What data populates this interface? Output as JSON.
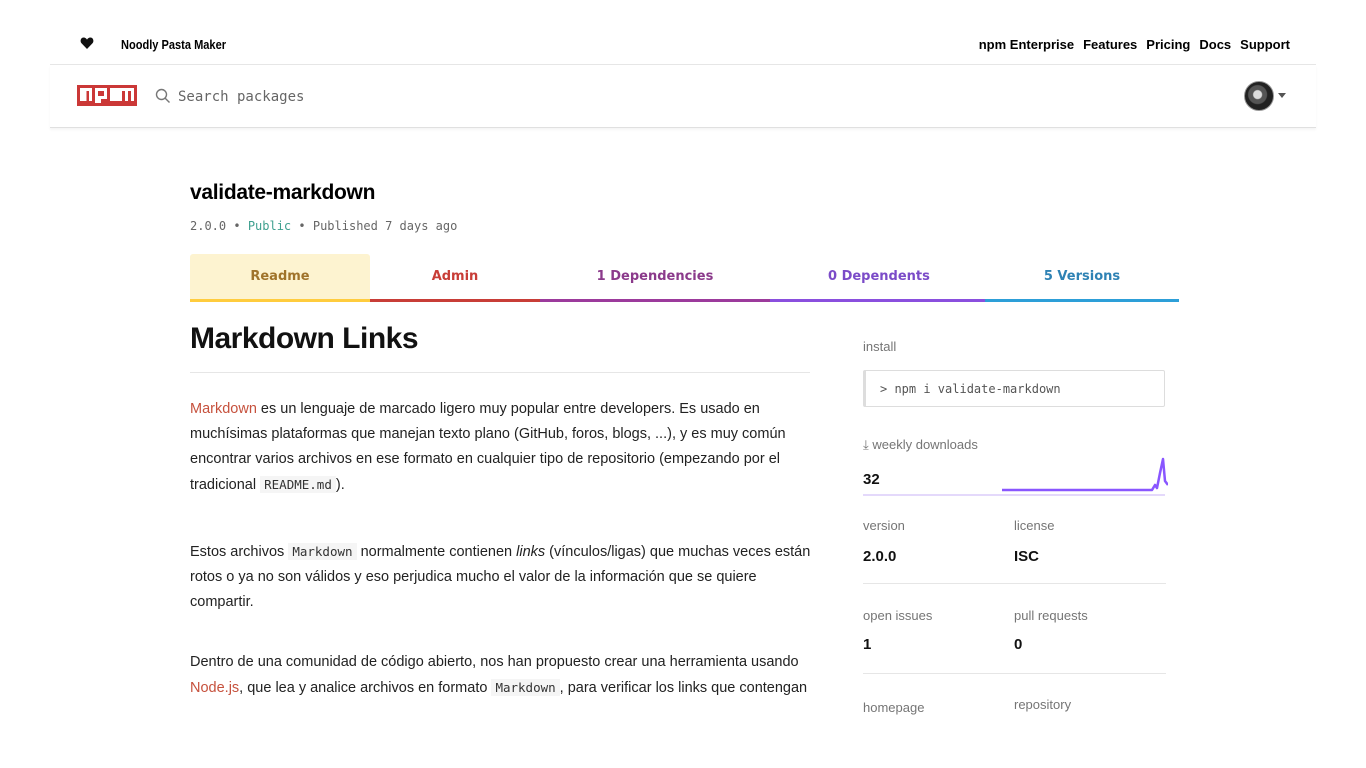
{
  "topbar": {
    "tagline": "Noodly Pasta Maker",
    "links": [
      "npm Enterprise",
      "Features",
      "Pricing",
      "Docs",
      "Support"
    ]
  },
  "search": {
    "placeholder": "Search packages"
  },
  "package": {
    "name": "validate-markdown",
    "version": "2.0.0",
    "visibility": "Public",
    "published": "Published 7 days ago"
  },
  "tabs": {
    "readme": "Readme",
    "admin": "Admin",
    "dependencies": "1 Dependencies",
    "dependents": "0 Dependents",
    "versions": "5 Versions"
  },
  "readme": {
    "heading": "Markdown Links",
    "p1": {
      "link": "Markdown",
      "text_a": " es un lenguaje de marcado ligero muy popular entre developers. Es usado en muchísimas plataformas que manejan texto plano (GitHub, foros, blogs, ...), y es muy común encontrar varios archivos en ese formato en cualquier tipo de repositorio (empezando por el tradicional ",
      "code": "README.md",
      "text_b": ")."
    },
    "p2": {
      "text_a": "Estos archivos ",
      "code": "Markdown",
      "text_b": " normalmente contienen ",
      "em": "links",
      "text_c": " (vínculos/ligas) que muchas veces están rotos o ya no son válidos y eso perjudica mucho el valor de la información que se quiere compartir."
    },
    "p3": {
      "text_a": "Dentro de una comunidad de código abierto, nos han propuesto crear una herramienta usando ",
      "link": "Node.js",
      "text_b": ", que lea y analice archivos en formato ",
      "code": "Markdown",
      "text_c": ", para verificar los links que contengan"
    }
  },
  "sidebar": {
    "install_label": "install",
    "install_cmd": "> npm i validate-markdown",
    "downloads_label": "weekly downloads",
    "downloads": "32",
    "version_label": "version",
    "version": "2.0.0",
    "license_label": "license",
    "license": "ISC",
    "issues_label": "open issues",
    "issues": "1",
    "prs_label": "pull requests",
    "prs": "0",
    "homepage_label": "homepage",
    "repository_label": "repository"
  },
  "colors": {
    "accent": "#c6513d",
    "readme_tab": "#ffcc3e",
    "admin_tab": "#c83d37",
    "deps_tab": "#9c3a9c",
    "dependents_tab": "#8a4fde",
    "versions_tab": "#2d9fd8",
    "sparkline": "#8956ff"
  }
}
